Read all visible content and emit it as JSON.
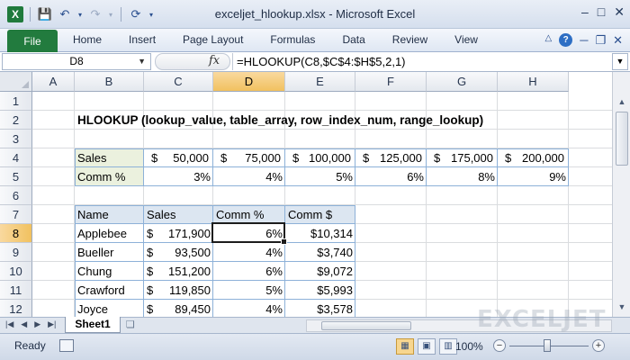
{
  "window": {
    "title": "exceljet_hlookup.xlsx - Microsoft Excel",
    "logo": "X",
    "controls": [
      "–",
      "□",
      "✕"
    ]
  },
  "ribbon": {
    "file_tab": "File",
    "tabs": [
      "Home",
      "Insert",
      "Page Layout",
      "Formulas",
      "Data",
      "Review",
      "View"
    ]
  },
  "formula_bar": {
    "name_box": "D8",
    "fx": "fx",
    "formula": "=HLOOKUP(C8,$C$4:$H$5,2,1)"
  },
  "columns": [
    "A",
    "B",
    "C",
    "D",
    "E",
    "F",
    "G",
    "H"
  ],
  "rows": [
    "1",
    "2",
    "3",
    "4",
    "5",
    "6",
    "7",
    "8",
    "9",
    "10",
    "11",
    "12"
  ],
  "selected_cell": "D8",
  "sheet": {
    "title": "HLOOKUP (lookup_value, table_array, row_index_num, range_lookup)",
    "lookup_table": {
      "sales_label": "Sales",
      "comm_label": "Comm %",
      "sales": [
        "50,000",
        "75,000",
        "100,000",
        "125,000",
        "175,000",
        "200,000"
      ],
      "comm": [
        "3%",
        "4%",
        "5%",
        "6%",
        "8%",
        "9%"
      ]
    },
    "data_table": {
      "headers": [
        "Name",
        "Sales",
        "Comm %",
        "Comm $"
      ],
      "rows": [
        {
          "name": "Applebee",
          "sales": "171,900",
          "pct": "6%",
          "amt": "$10,314"
        },
        {
          "name": "Bueller",
          "sales": "93,500",
          "pct": "4%",
          "amt": "$3,740"
        },
        {
          "name": "Chung",
          "sales": "151,200",
          "pct": "6%",
          "amt": "$9,072"
        },
        {
          "name": "Crawford",
          "sales": "119,850",
          "pct": "5%",
          "amt": "$5,993"
        },
        {
          "name": "Joyce",
          "sales": "89,450",
          "pct": "4%",
          "amt": "$3,578"
        }
      ]
    },
    "currency": "$"
  },
  "tabbar": {
    "sheet_tab": "Sheet1",
    "watermark": "EXCELJET"
  },
  "status": {
    "ready": "Ready",
    "zoom": "100%"
  },
  "colors": {
    "selection": "#1d1d1d",
    "header_highlight": "#f1c15f",
    "table_fill_label": "#ebf1de",
    "table_header_fill": "#dce6f1",
    "file_tab": "#227b3e"
  }
}
